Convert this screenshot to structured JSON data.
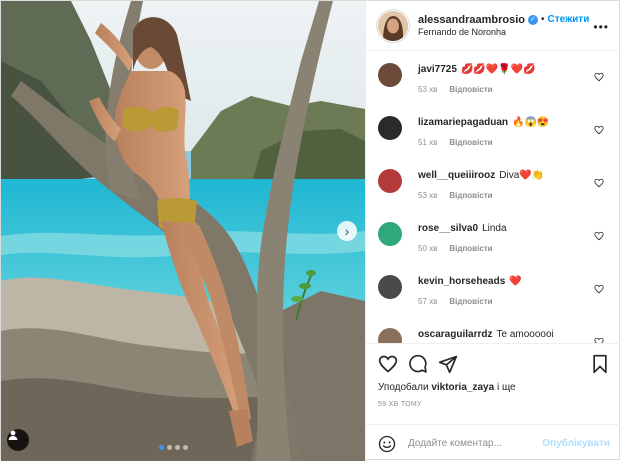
{
  "header": {
    "username": "alessandraambrosio",
    "separator": "•",
    "follow_label": "Стежити",
    "location": "Fernando de Noronha",
    "more_label": "•••"
  },
  "photo": {
    "next_glyph": "›",
    "dots": 4,
    "active_dot": 0,
    "colors": {
      "sea": "#3fc3d6",
      "sky": "#e7eef0",
      "rock": "#7a7265",
      "accent": "#3897f0"
    }
  },
  "comments": [
    {
      "user": "javi7725",
      "text": "💋💋❤️🌹❤️💋",
      "time": "53 хв",
      "reply": "Відповісти",
      "avatar_color": "#6b4a3a"
    },
    {
      "user": "lizamariepagaduan",
      "text": "🔥😱😍",
      "time": "51 хв",
      "reply": "Відповісти",
      "avatar_color": "#2a2a2a"
    },
    {
      "user": "well__queiiirooz",
      "text": "Diva❤️👏",
      "time": "53 хв",
      "reply": "Відповісти",
      "avatar_color": "#b33b3b"
    },
    {
      "user": "rose__silva0",
      "text": "Linda",
      "time": "50 хв",
      "reply": "Відповісти",
      "avatar_color": "#2fa87a"
    },
    {
      "user": "kevin_horseheads",
      "text": "❤️",
      "time": "57 хв",
      "reply": "Відповісти",
      "avatar_color": "#4a4a4a"
    },
    {
      "user": "oscaraguilarrdz",
      "text": "Te amoooooi",
      "time": "",
      "reply": "",
      "avatar_color": "#8a6f5a"
    }
  ],
  "actions": {
    "icons": [
      "heart-icon",
      "comment-icon",
      "share-icon",
      "bookmark-icon"
    ],
    "liked_prefix": "Уподобали",
    "liked_user": "viktoria_zaya",
    "liked_suffix": "і ще",
    "timestamp": "59 ХВ ТОМУ"
  },
  "add_comment": {
    "placeholder": "Додайте коментар...",
    "publish_label": "Опублікувати"
  }
}
